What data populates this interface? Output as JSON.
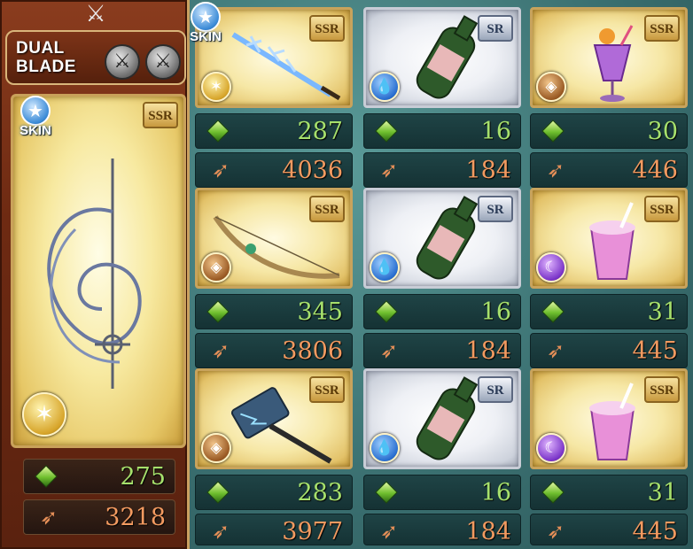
{
  "main_weapon": {
    "proficiency_label": "DUAL BLADE",
    "proficiency_icons": [
      "sword-icon",
      "sword-icon"
    ],
    "skin_label": "SKIN",
    "rarity": "SSR",
    "element": "light",
    "art": "spiral-rapier",
    "hp": "275",
    "atk": "3218"
  },
  "grid": [
    {
      "art": "ice-sword",
      "rarity": "SSR",
      "element": "light",
      "skin": "SKIN",
      "hp": "287",
      "atk": "4036"
    },
    {
      "art": "wine-bottle",
      "rarity": "SR",
      "element": "water",
      "hp": "16",
      "atk": "184"
    },
    {
      "art": "tropical-drink",
      "rarity": "SSR",
      "element": "earth",
      "hp": "30",
      "atk": "446"
    },
    {
      "art": "ornate-bow",
      "rarity": "SSR",
      "element": "earth",
      "hp": "345",
      "atk": "3806"
    },
    {
      "art": "wine-bottle",
      "rarity": "SR",
      "element": "water",
      "hp": "16",
      "atk": "184"
    },
    {
      "art": "pink-shake",
      "rarity": "SSR",
      "element": "dark",
      "hp": "31",
      "atk": "445"
    },
    {
      "art": "lightning-hammer",
      "rarity": "SSR",
      "element": "earth",
      "hp": "283",
      "atk": "3977"
    },
    {
      "art": "wine-bottle",
      "rarity": "SR",
      "element": "water",
      "hp": "16",
      "atk": "184"
    },
    {
      "art": "pink-shake",
      "rarity": "SSR",
      "element": "dark",
      "hp": "31",
      "atk": "445"
    }
  ],
  "colors": {
    "hp_text": "#a6e06c",
    "atk_text": "#f29a60",
    "background": "#3f7a7a",
    "main_panel": "#6e2a12"
  }
}
